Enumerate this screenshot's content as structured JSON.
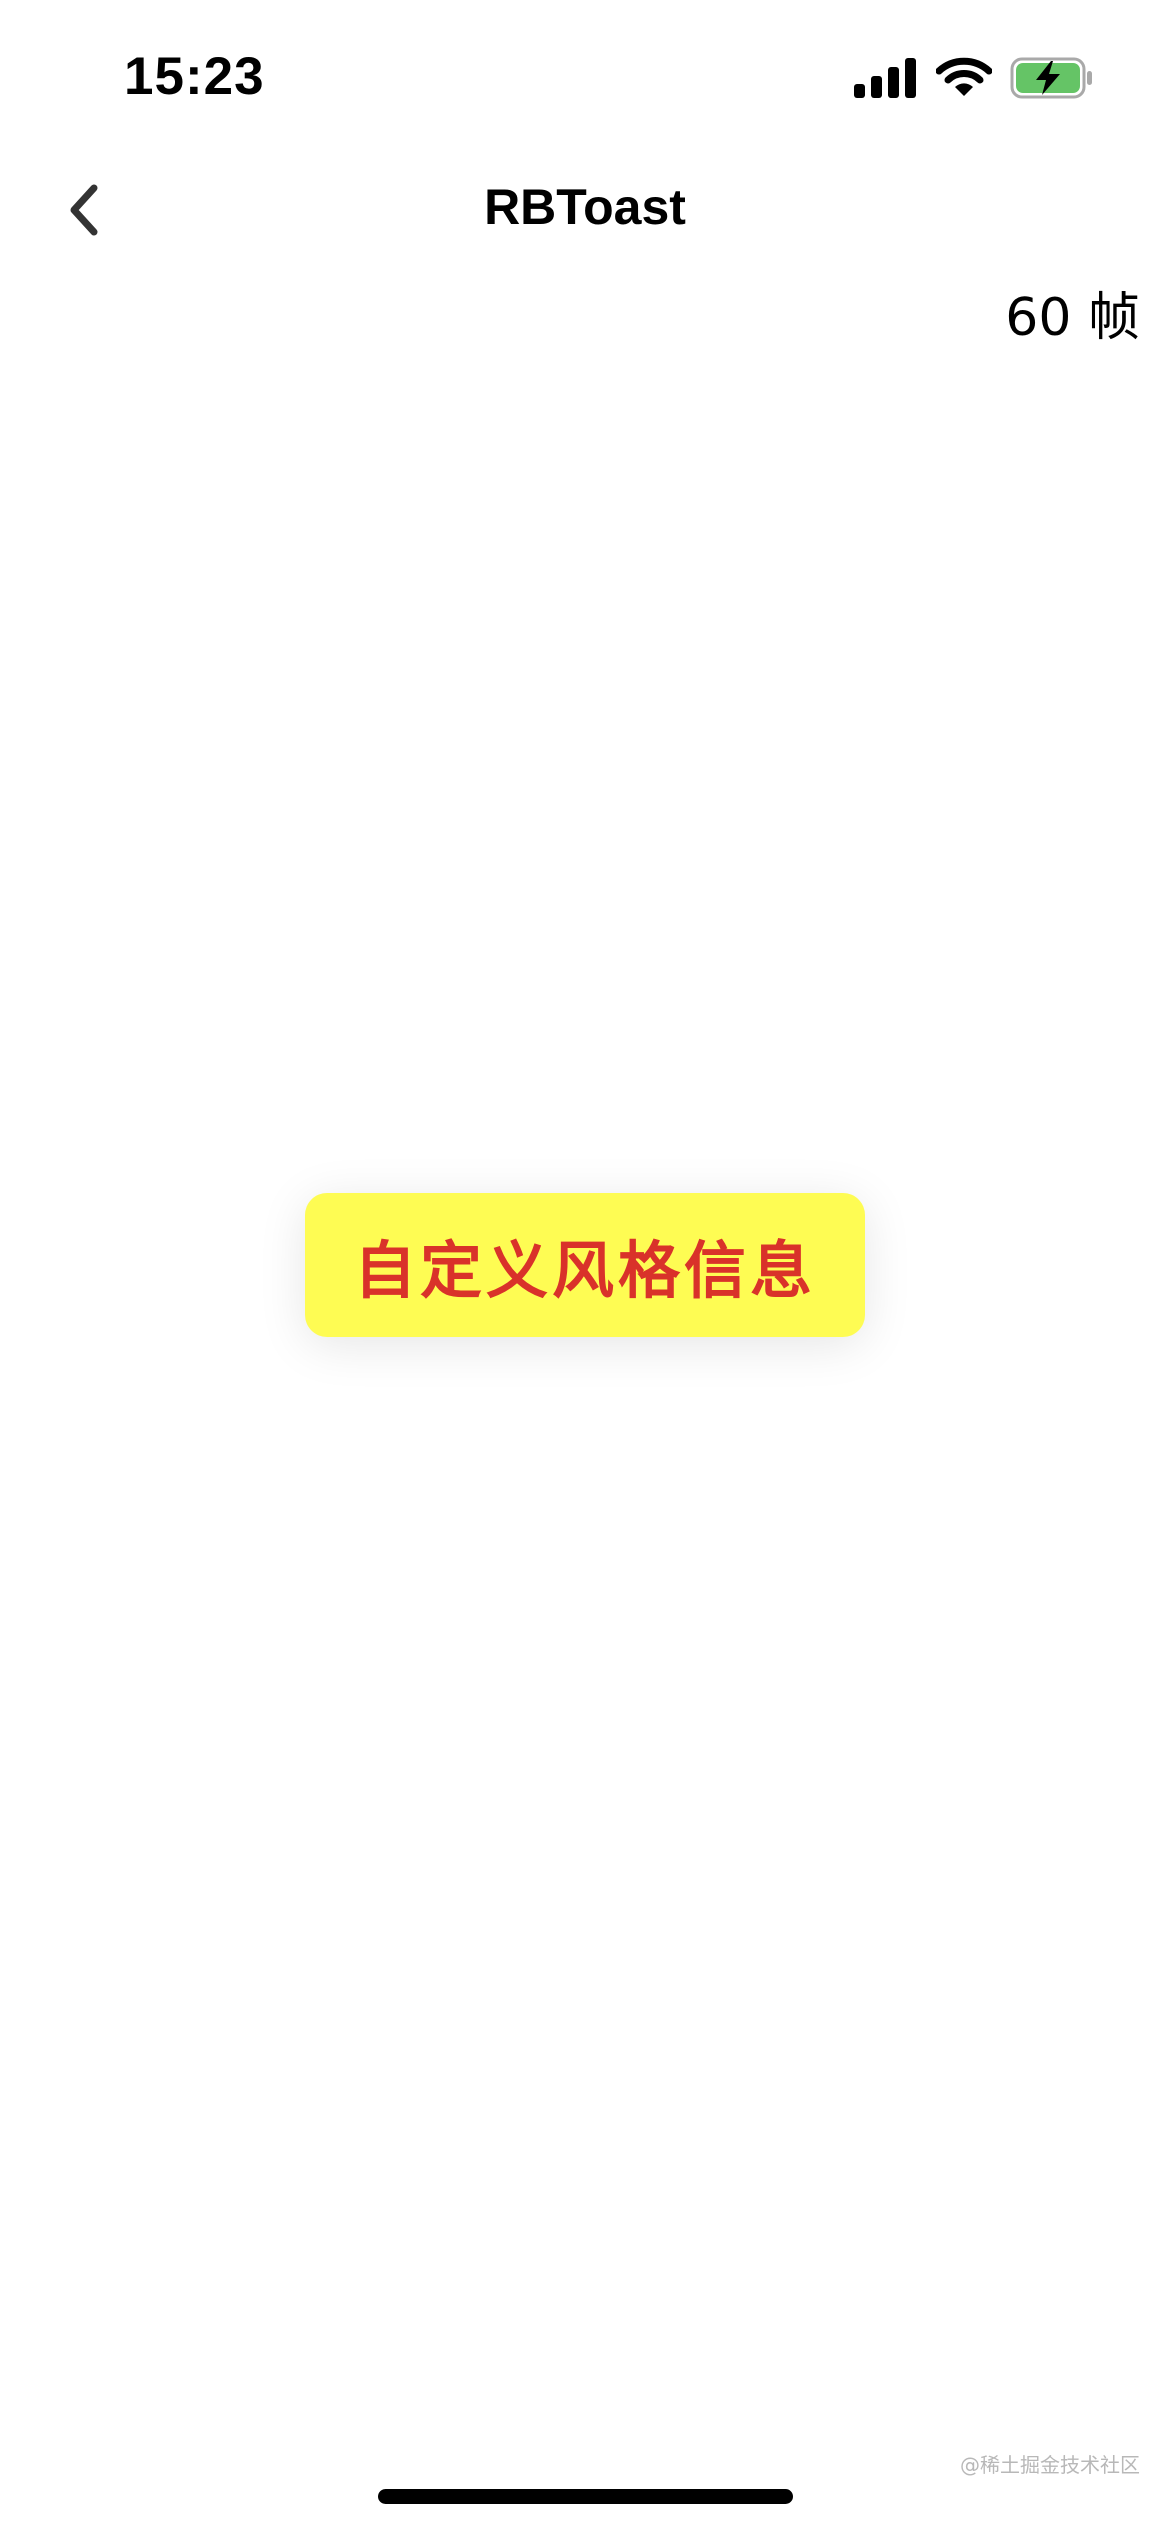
{
  "status_bar": {
    "time": "15:23",
    "icons": [
      "cellular-signal-icon",
      "wifi-icon",
      "battery-charging-icon"
    ],
    "battery_color": "#65c466"
  },
  "nav": {
    "back_icon": "chevron-left-icon",
    "title": "RBToast"
  },
  "fps": {
    "label": "60 帧"
  },
  "toast": {
    "message": "自定义风格信息",
    "background_color": "#fefc53",
    "text_color": "#d9322a"
  },
  "watermark": {
    "text": "@稀土掘金技术社区"
  }
}
